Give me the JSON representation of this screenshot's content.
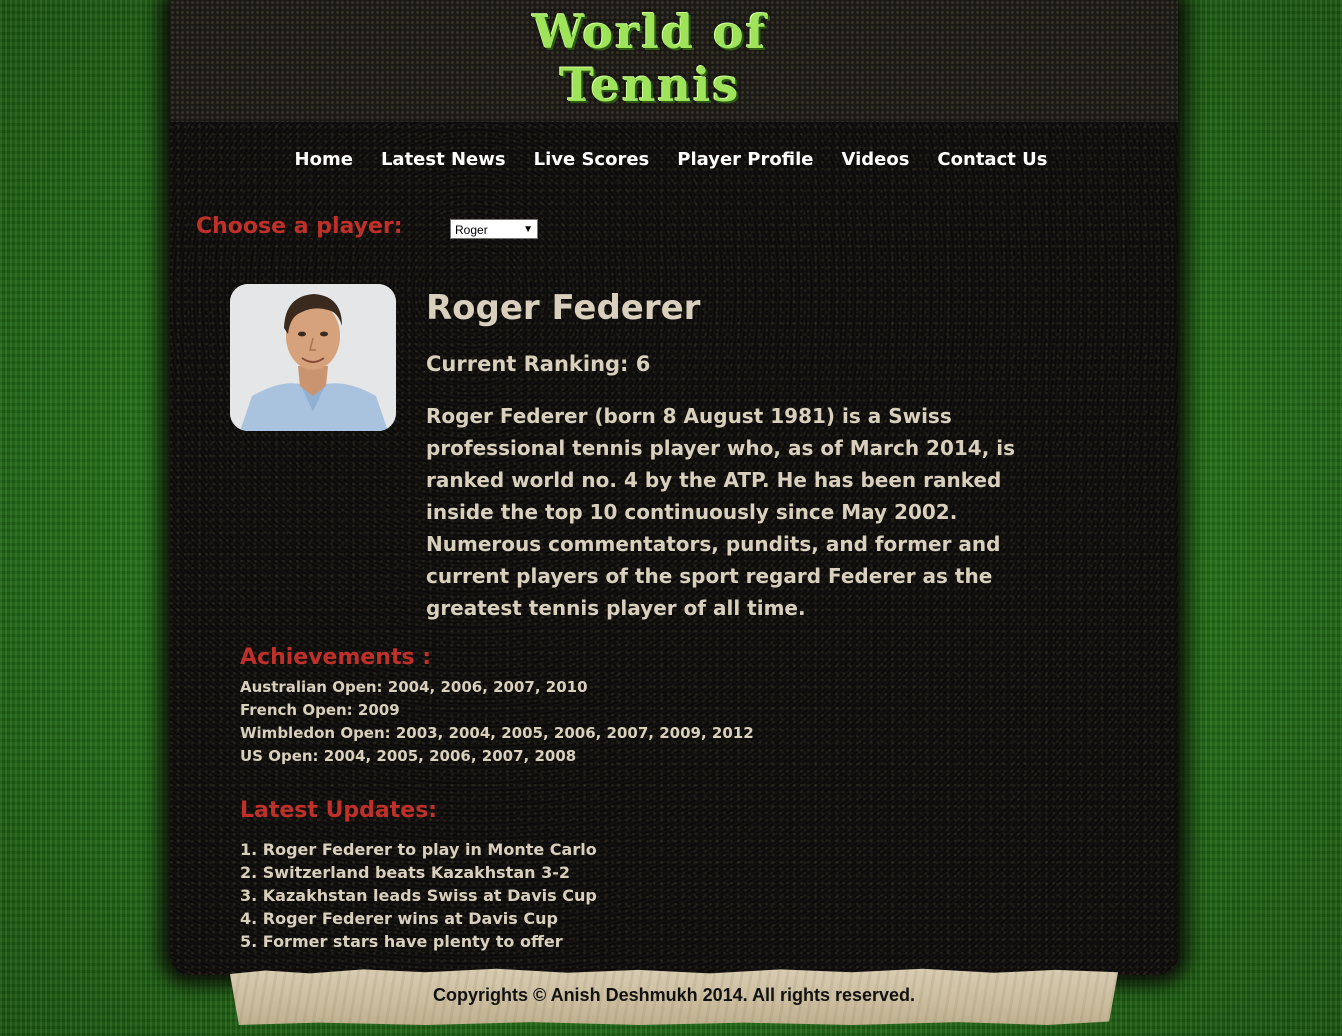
{
  "logo": {
    "line1": "World of",
    "line2": "Tennis"
  },
  "nav": {
    "items": [
      "Home",
      "Latest News",
      "Live Scores",
      "Player Profile",
      "Videos",
      "Contact Us"
    ]
  },
  "player_selector": {
    "label": "Choose a player:",
    "selected": "Roger"
  },
  "player": {
    "name": "Roger Federer",
    "ranking": "Current Ranking: 6",
    "bio": "Roger Federer (born 8 August 1981) is a Swiss professional tennis player who, as of March 2014, is ranked world no. 4 by the ATP. He has been ranked inside the top 10 continuously since May 2002. Numerous commentators, pundits, and former and current players of the sport regard Federer as the greatest tennis player of all time."
  },
  "achievements": {
    "title": "Achievements :",
    "items": [
      "Australian Open: 2004, 2006, 2007, 2010",
      "French Open: 2009",
      "Wimbledon Open: 2003, 2004, 2005, 2006, 2007, 2009, 2012",
      "US Open: 2004, 2005, 2006, 2007, 2008"
    ]
  },
  "updates": {
    "title": "Latest Updates:",
    "items": [
      "1. Roger Federer to play in Monte Carlo",
      "2. Switzerland beats Kazakhstan 3-2",
      "3. Kazakhstan leads Swiss at Davis Cup",
      "4. Roger Federer wins at Davis Cup",
      "5. Former stars have plenty to offer"
    ]
  },
  "footer": {
    "copyright": "Copyrights © Anish Deshmukh 2014. All rights reserved."
  },
  "colors": {
    "accent_red": "#c0302a",
    "logo_green": "#9fe35a",
    "body_text": "#d8d0bc",
    "panel": "#0d0c0b"
  }
}
